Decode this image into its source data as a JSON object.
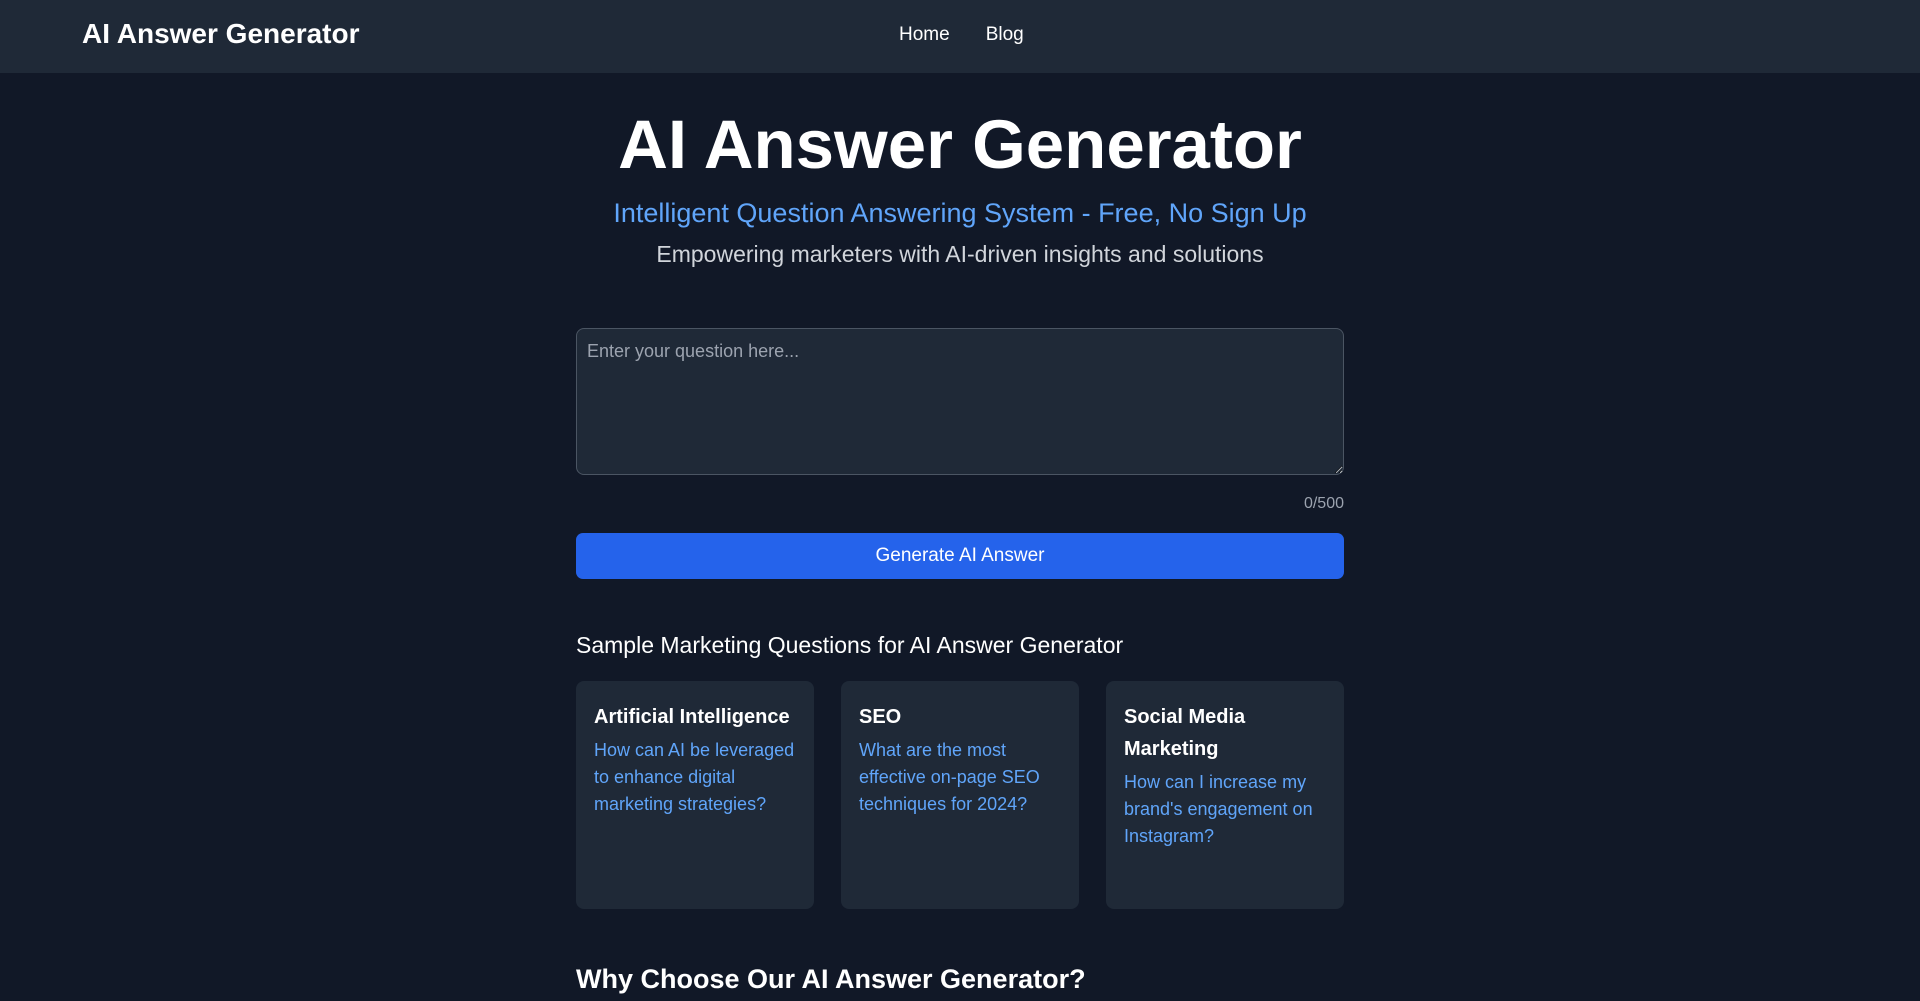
{
  "navbar": {
    "brand": "AI Answer Generator",
    "links": [
      "Home",
      "Blog"
    ]
  },
  "hero": {
    "title": "AI Answer Generator",
    "subtitle": "Intelligent Question Answering System - Free, No Sign Up",
    "tagline": "Empowering marketers with AI-driven insights and solutions"
  },
  "question_form": {
    "value": "",
    "placeholder": "Enter your question here...",
    "char_count": "0/500",
    "submit_label": "Generate AI Answer"
  },
  "samples": {
    "heading": "Sample Marketing Questions for AI Answer Generator",
    "cards": [
      {
        "title": "Artificial Intelligence",
        "question": "How can AI be leveraged to enhance digital marketing strategies?"
      },
      {
        "title": "SEO",
        "question": "What are the most effective on-page SEO techniques for 2024?"
      },
      {
        "title": "Social Media Marketing",
        "question": "How can I increase my brand's engagement on Instagram?"
      }
    ]
  },
  "why_section": {
    "heading": "Why Choose Our AI Answer Generator?"
  },
  "colors": {
    "background": "#111827",
    "surface": "#1f2937",
    "accent": "#2563eb",
    "link": "#60a5fa"
  }
}
